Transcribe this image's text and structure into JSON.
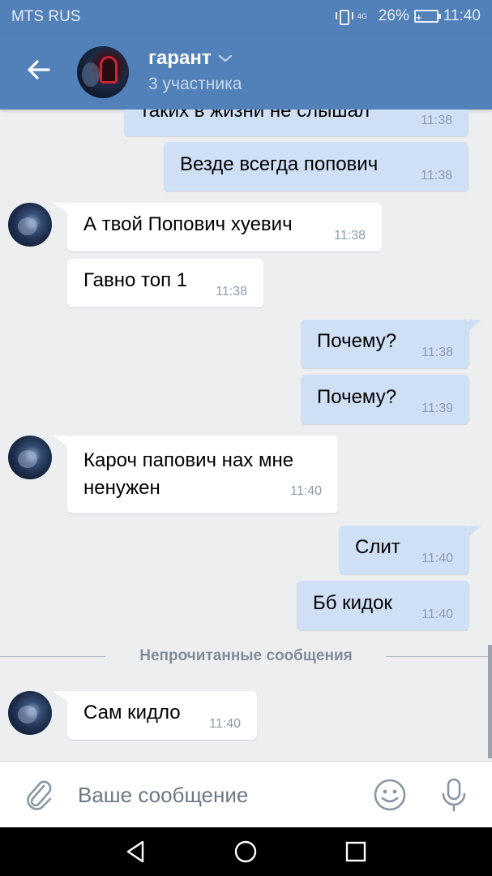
{
  "status_bar": {
    "carrier": "MTS RUS",
    "network": "4G",
    "battery": "26%",
    "time": "11:40"
  },
  "header": {
    "title": "гарант",
    "subtitle": "3 участника"
  },
  "messages": [
    {
      "dir": "out",
      "text": "таких в жизни не слышал",
      "time": "11:38"
    },
    {
      "dir": "out",
      "text": "Везде всегда попович",
      "time": "11:38"
    },
    {
      "dir": "in",
      "text": "А твой Попович хуевич",
      "time": "11:38"
    },
    {
      "dir": "in",
      "text": "Гавно топ 1",
      "time": "11:38"
    },
    {
      "dir": "out",
      "text": "Почему?",
      "time": "11:38"
    },
    {
      "dir": "out",
      "text": "Почему?",
      "time": "11:39"
    },
    {
      "dir": "in",
      "text_line1": "Кароч папович нах мне",
      "text_line2": "ненужен",
      "time": "11:40"
    },
    {
      "dir": "out",
      "text": "Слит",
      "time": "11:40"
    },
    {
      "dir": "out",
      "text": "Бб кидок",
      "time": "11:40"
    },
    {
      "dir": "in",
      "text": "Сам кидло",
      "time": "11:40"
    }
  ],
  "unread_divider": "Непрочитанные сообщения",
  "composer": {
    "placeholder": "Ваше сообщение"
  },
  "icons": {
    "back": "arrow-left-icon",
    "dropdown": "chevron-down-icon",
    "attach": "paperclip-icon",
    "emoji": "smile-icon",
    "voice": "microphone-icon"
  },
  "colors": {
    "header": "#5181b8",
    "outgoing_bubble": "#cfe0f5",
    "incoming_bubble": "#ffffff",
    "background": "#edeef0"
  }
}
